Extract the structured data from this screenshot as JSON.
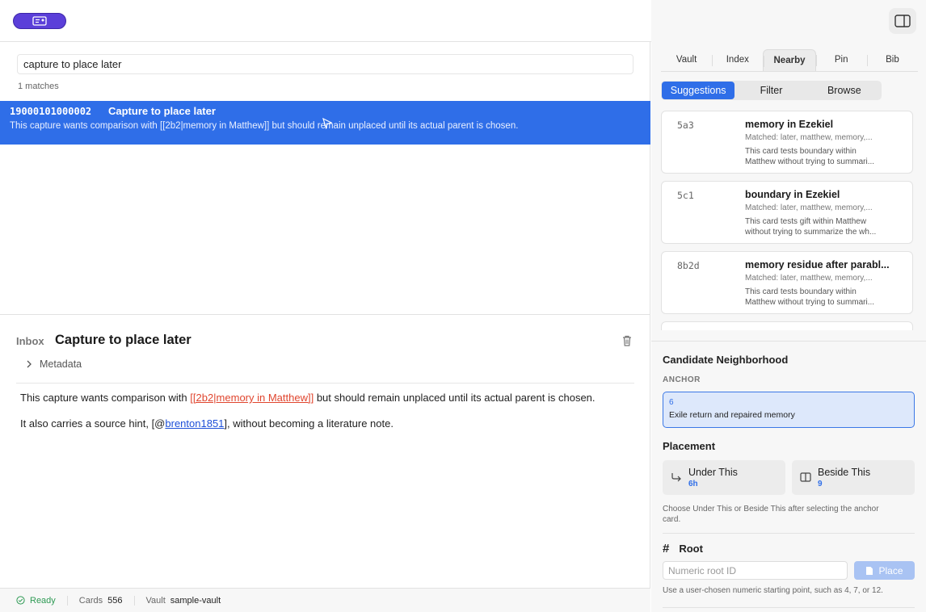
{
  "colors": {
    "accent": "#2f6ee8",
    "brand": "#5b3fd9",
    "link_red": "#e0452e",
    "ready_green": "#2e9a54"
  },
  "search": {
    "value": "capture to place later",
    "match_count": "1 matches"
  },
  "result": {
    "id": "19000101000002",
    "title": "Capture to place later",
    "snippet": "This capture wants comparison with [[2b2|memory in Matthew]] but should remain unplaced until its actual parent is chosen."
  },
  "detail": {
    "kicker": "Inbox",
    "title": "Capture to place later",
    "metadata_label": "Metadata",
    "p1_before": "This capture wants comparison with ",
    "p1_link": "[[2b2|memory in Matthew]]",
    "p1_after": " but should remain unplaced until its actual parent is chosen.",
    "p2_before": "It also carries a source hint, [@",
    "p2_link": "brenton1851",
    "p2_after": "], without becoming a literature note."
  },
  "status": {
    "ready": "Ready",
    "cards_label": "Cards",
    "cards_value": "556",
    "vault_label": "Vault",
    "vault_value": "sample-vault"
  },
  "tabs": [
    "Vault",
    "Index",
    "Nearby",
    "Pin",
    "Bib"
  ],
  "subtabs": [
    "Suggestions",
    "Filter",
    "Browse"
  ],
  "suggestions": [
    {
      "id": "5a3",
      "title": "memory in Ezekiel",
      "matched": "Matched: later, matthew, memory,...",
      "desc1": "This card tests boundary within",
      "desc2": "Matthew without trying to summari..."
    },
    {
      "id": "5c1",
      "title": "boundary in Ezekiel",
      "matched": "Matched: later, matthew, memory,...",
      "desc1": "This card tests gift within Matthew",
      "desc2": "without trying to summarize the wh..."
    },
    {
      "id": "8b2d",
      "title": "memory residue after parabl...",
      "matched": "Matched: later, matthew, memory,...",
      "desc1": "This card tests boundary within",
      "desc2": "Matthew without trying to summari..."
    }
  ],
  "neighborhood": {
    "heading": "Candidate Neighborhood",
    "anchor_label": "ANCHOR",
    "anchor_id": "6",
    "anchor_title": "Exile return and repaired memory"
  },
  "placement": {
    "heading": "Placement",
    "under_label": "Under This",
    "under_sub": "6h",
    "beside_label": "Beside This",
    "beside_sub": "9",
    "help": "Choose Under This or Beside This after selecting the anchor card."
  },
  "root": {
    "heading": "Root",
    "input_placeholder": "Numeric root ID",
    "place_label": "Place",
    "help": "Use a user-chosen numeric starting point, such as 4, 7, or 12."
  }
}
